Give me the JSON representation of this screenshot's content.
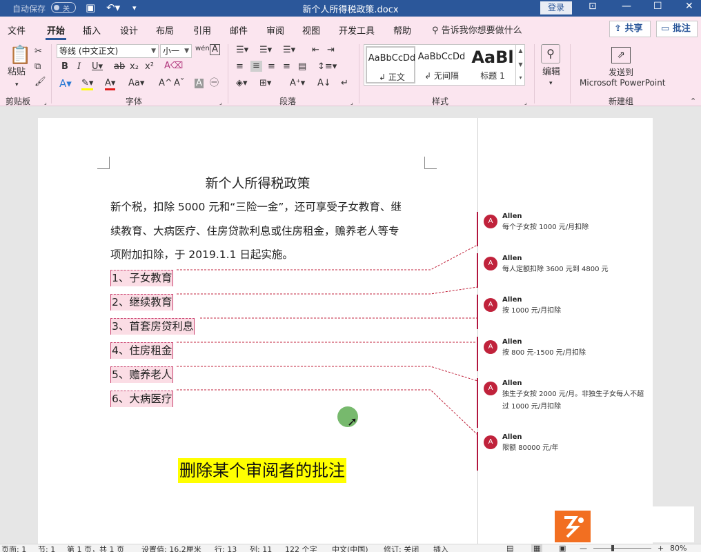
{
  "titlebar": {
    "autosave": "自动保存",
    "toggle": "关",
    "doc_title": "新个人所得税政策.docx",
    "login": "登录"
  },
  "tabs": [
    "文件",
    "开始",
    "插入",
    "设计",
    "布局",
    "引用",
    "邮件",
    "审阅",
    "视图",
    "开发工具",
    "帮助"
  ],
  "tellme": "告诉我你想要做什么",
  "share": "共享",
  "comments_btn": "批注",
  "ribbon": {
    "clipboard": {
      "paste": "粘贴",
      "label": "剪贴板"
    },
    "font": {
      "name": "等线 (中文正文)",
      "size": "小一",
      "label": "字体"
    },
    "paragraph": {
      "label": "段落"
    },
    "styles": {
      "label": "样式",
      "items": [
        {
          "sample": "AaBbCcDd",
          "name": "正文"
        },
        {
          "sample": "AaBbCcDd",
          "name": "无间隔"
        },
        {
          "sample": "AaBl",
          "name": "标题 1"
        }
      ]
    },
    "editing": {
      "label": "编辑"
    },
    "newgroup": {
      "send1": "发送到",
      "send2": "Microsoft PowerPoint",
      "label": "新建组"
    }
  },
  "document": {
    "title": "新个人所得税政策",
    "paragraph": [
      "新个税，扣除 5000 元和“三险一金”，还可享受子女教育、继",
      "续教育、大病医疗、住房贷款利息或住房租金，赡养老人等专",
      "项附加扣除，于 2019.1.1 日起实施。"
    ],
    "items": [
      "1、子女教育",
      "2、继续教育",
      "3、首套房贷利息",
      "4、住房租金",
      "5、赡养老人",
      "6、大病医疗"
    ],
    "caption": "删除某个审阅者的批注"
  },
  "comments": [
    {
      "initial": "A",
      "author": "Allen",
      "text": "每个子女按 1000 元/月扣除"
    },
    {
      "initial": "A",
      "author": "Allen",
      "text": "每人定额扣除 3600 元到 4800 元"
    },
    {
      "initial": "A",
      "author": "Allen",
      "text": "按 1000 元/月扣除"
    },
    {
      "initial": "A",
      "author": "Allen",
      "text": "按 800 元-1500 元/月扣除"
    },
    {
      "initial": "A",
      "author": "Allen",
      "text": "独生子女按 2000 元/月。非独生子女每人不超过 1000 元/月扣除"
    },
    {
      "initial": "A",
      "author": "Allen",
      "text": "限额 80000 元/年"
    }
  ],
  "statusbar": {
    "page": "页面: 1",
    "section": "节: 1",
    "pages": "第 1 页，共 1 页",
    "position": "设置值: 16.2厘米",
    "line": "行: 13",
    "column": "列: 11",
    "words": "122 个字",
    "language": "中文(中国)",
    "revisions": "修订: 关闭",
    "insert": "插入",
    "zoom": "80%"
  },
  "colors": {
    "accent": "#2b579a",
    "ribbon": "#fbe5ef",
    "comment": "#c0223b",
    "highlight": "#ffff00"
  }
}
